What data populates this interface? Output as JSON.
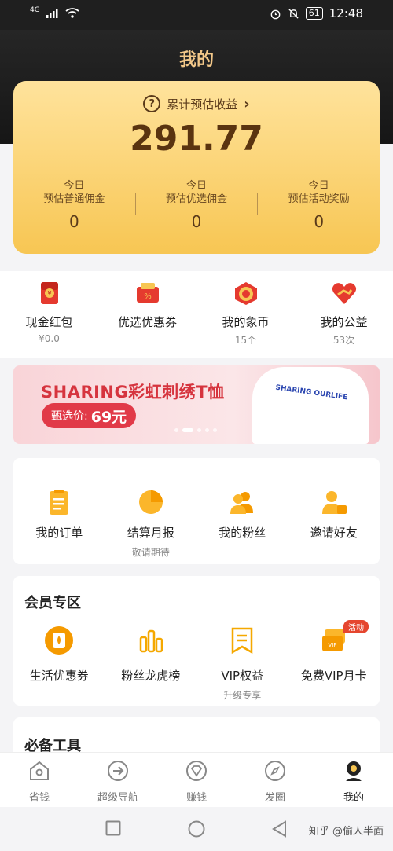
{
  "status_bar": {
    "network": "4G",
    "time": "12:48",
    "battery": "61"
  },
  "header": {
    "title": "我的"
  },
  "earnings": {
    "label": "累计预估收益",
    "total": "291.77",
    "columns": [
      {
        "line1": "今日",
        "line2": "预估普通佣金",
        "value": "0"
      },
      {
        "line1": "今日",
        "line2": "预估优选佣金",
        "value": "0"
      },
      {
        "line1": "今日",
        "line2": "预估活动奖励",
        "value": "0"
      }
    ]
  },
  "wallet": [
    {
      "label": "现金红包",
      "sub": "¥0.0",
      "icon": "red-envelope-icon"
    },
    {
      "label": "优选优惠券",
      "sub": "",
      "icon": "coupon-icon"
    },
    {
      "label": "我的象币",
      "sub": "15个",
      "icon": "elephant-coin-icon"
    },
    {
      "label": "我的公益",
      "sub": "53次",
      "icon": "charity-heart-icon"
    }
  ],
  "banner": {
    "title": "SHARING彩虹刺绣T恤",
    "price_label": "甄选价:",
    "price": "69元",
    "shirt_text": "SHARING OURLIFE"
  },
  "orders": [
    {
      "label": "我的订单",
      "sub": "",
      "icon": "order-list-icon"
    },
    {
      "label": "结算月报",
      "sub": "敬请期待",
      "icon": "pie-chart-icon"
    },
    {
      "label": "我的粉丝",
      "sub": "",
      "icon": "fans-icon"
    },
    {
      "label": "邀请好友",
      "sub": "",
      "icon": "invite-friend-icon"
    }
  ],
  "member": {
    "title": "会员专区",
    "items": [
      {
        "label": "生活优惠券",
        "sub": "",
        "icon": "life-coupon-icon"
      },
      {
        "label": "粉丝龙虎榜",
        "sub": "",
        "icon": "ranking-bars-icon"
      },
      {
        "label": "VIP权益",
        "sub": "升级专享",
        "icon": "vip-bookmark-icon"
      },
      {
        "label": "免费VIP月卡",
        "sub": "",
        "icon": "vip-card-icon",
        "badge": "活动"
      }
    ]
  },
  "tools": {
    "title": "必备工具"
  },
  "tabbar": [
    {
      "label": "省钱",
      "icon": "home-icon"
    },
    {
      "label": "超级导航",
      "icon": "navigation-arrow-icon"
    },
    {
      "label": "赚钱",
      "icon": "diamond-icon"
    },
    {
      "label": "发圈",
      "icon": "compass-icon"
    },
    {
      "label": "我的",
      "icon": "profile-avatar-icon"
    }
  ],
  "watermark": "知乎 @偷人半面",
  "colors": {
    "accent_gold": "#f7c653",
    "header_dark": "#1f1f1f",
    "brand_red": "#e13a48"
  }
}
